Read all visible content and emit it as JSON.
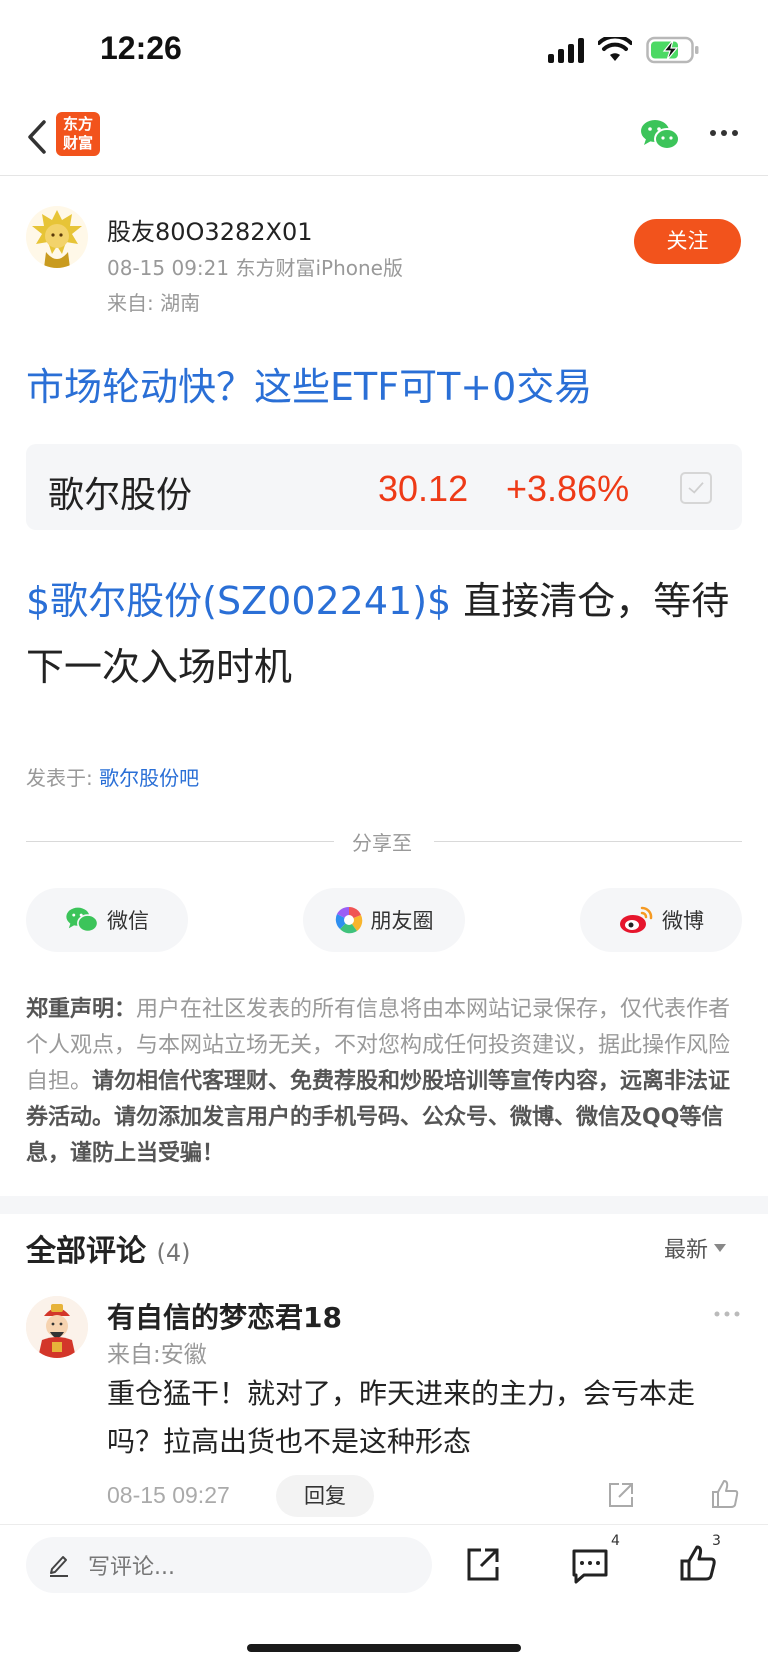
{
  "status_bar": {
    "time": "12:26"
  },
  "nav": {
    "logo_line1": "东方",
    "logo_line2": "财富"
  },
  "author": {
    "name": "股友80O3282X01",
    "meta": "08-15 09:21 东方财富iPhone版",
    "from": "来自: 湖南",
    "follow_label": "关注"
  },
  "post": {
    "title": "市场轮动快？这些ETF可T+0交易",
    "stock": {
      "name": "歌尔股份",
      "price": "30.12",
      "change": "+3.86%"
    },
    "body_link": "$歌尔股份(SZ002241)$",
    "body_text": " 直接清仓，等待下一次入场时机",
    "posted_in_label": "发表于:",
    "posted_in_link": "歌尔股份吧"
  },
  "share": {
    "label": "分享至",
    "wechat": "微信",
    "moments": "朋友圈",
    "weibo": "微博"
  },
  "disclaimer": {
    "heading": "郑重声明：",
    "normal": "用户在社区发表的所有信息将由本网站记录保存，仅代表作者个人观点，与本网站立场无关，不对您构成任何投资建议，据此操作风险自担。",
    "bold": "请勿相信代客理财、免费荐股和炒股培训等宣传内容，远离非法证券活动。请勿添加发言用户的手机号码、公众号、微博、微信及QQ等信息，谨防上当受骗！"
  },
  "comments": {
    "title": "全部评论",
    "count": "(4)",
    "sort_label": "最新",
    "items": [
      {
        "name": "有自信的梦恋君18",
        "from": "来自:安徽",
        "text": "重仓猛干！就对了，昨天进来的主力，会亏本走吗？拉高出货也不是这种形态",
        "time": "08-15 09:27",
        "reply_label": "回复"
      }
    ]
  },
  "bottom_bar": {
    "placeholder": "写评论...",
    "comment_count": "4",
    "like_count": "3"
  },
  "colors": {
    "brand": "#f2531c",
    "link": "#2a6fd6",
    "up": "#ee3a17"
  }
}
